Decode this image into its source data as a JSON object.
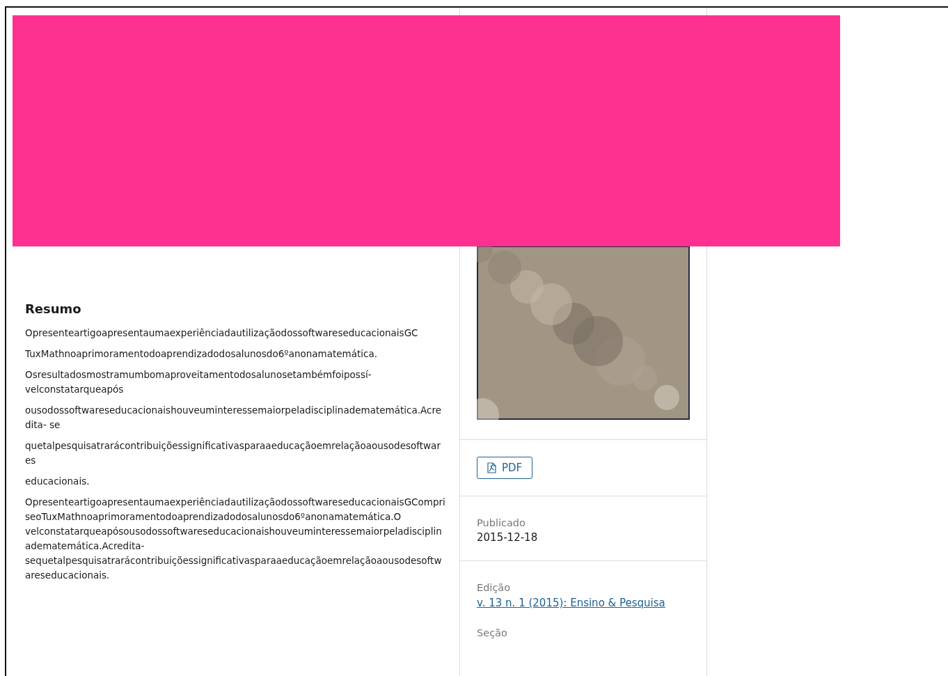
{
  "abstract": {
    "heading": "Resumo",
    "paragraphs": [
      "OpresenteartigoapresentaumaexperiênciadautilizaçãodossoftwareseducacionaisGC",
      "TuxMathnoaprimoramentodoaprendizadodosalunosdo6ºanonamatemática.",
      "Osresultadosmostramumbomaproveitamentodosalunosetambémfoipossí- velconstatarqueapós",
      "ousodossoftwareseducacionaishouveuminteressemaiorpeladisciplinadematemática.Acredita- se",
      "quetalpesquisatrarácontribuiçõessignificativasparaaeducaçãoemrelaçãoaousodesoftwares",
      "educacionais.",
      "OpresenteartigoapresentaumaexperiênciadautilizaçãodossoftwareseducacionaisGCompriseoTuxMathnoaprimoramentodoaprendizadodosalunosdo6ºanonamatemática.O velconstatarqueapósousodossoftwareseducacionaishouveuminteressemaiorpeladisciplinadematemática.Acredita- sequetalpesquisatrarácontribuiçõessignificativasparaaeducaçãoemrelaçãoaousodesoftwareseducacionais."
    ]
  },
  "sidebar": {
    "download": {
      "label": "PDF"
    },
    "published": {
      "label": "Publicado",
      "value": "2015-12-18"
    },
    "issue": {
      "label": "Edição",
      "link": "v. 13 n. 1 (2015): Ensino & Pesquisa"
    },
    "section": {
      "label": "Seção"
    }
  }
}
